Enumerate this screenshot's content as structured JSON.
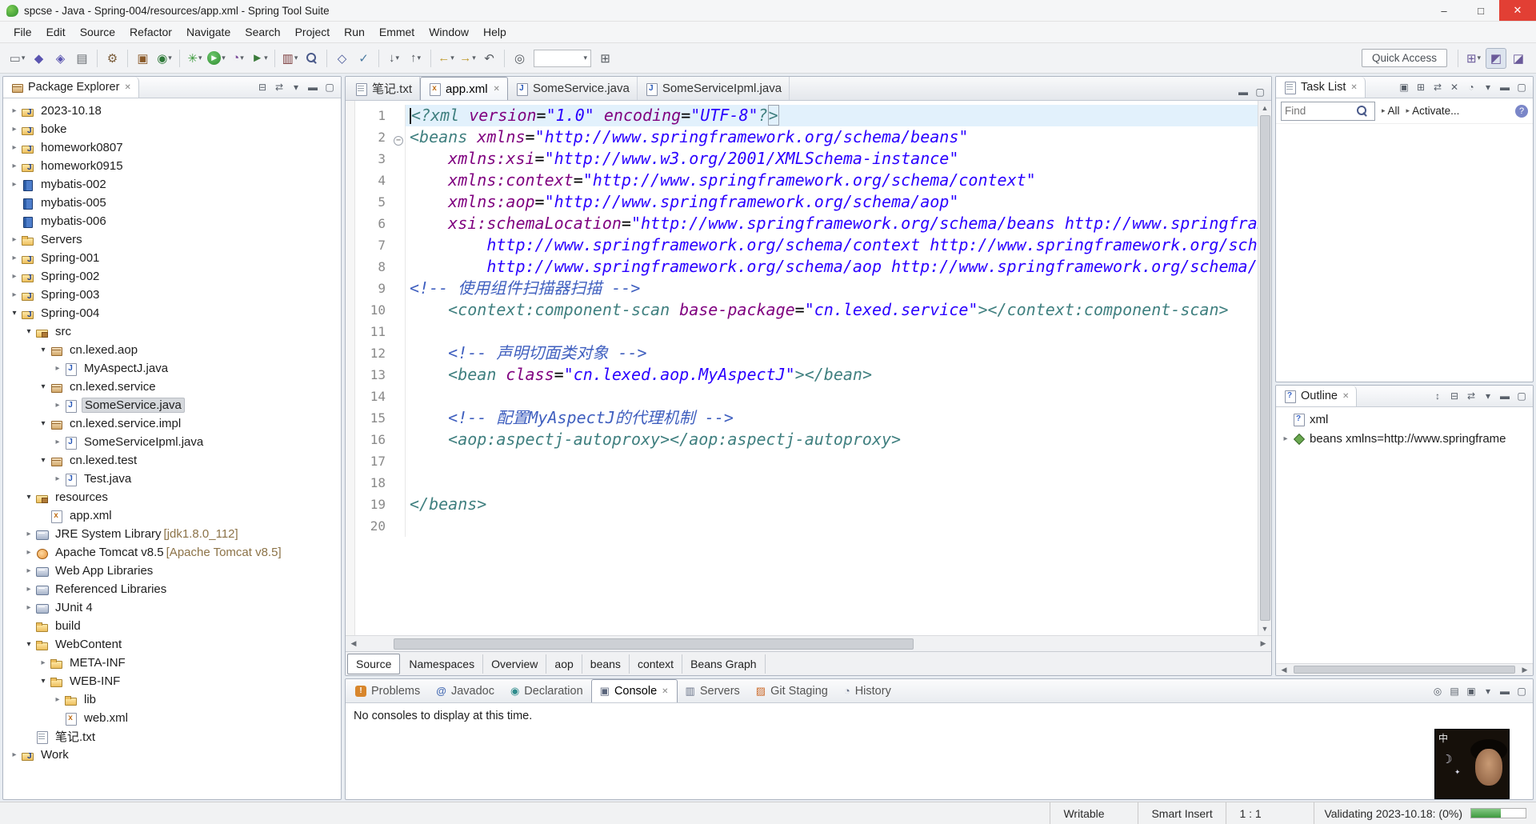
{
  "icons": {
    "window-minimize": "–",
    "window-maximize": "□",
    "window-close": "✕",
    "tab-close": "✕",
    "collapse-all": "⊟",
    "link-editor": "⇄",
    "view-menu": "▾",
    "sort": "↕",
    "minimize": "▬",
    "maximize": "▢",
    "scroll-left": "◀",
    "scroll-right": "▶",
    "scroll-up": "▲",
    "scroll-down": "▼",
    "new-task": "▣",
    "categorize": "⊞",
    "delete": "✕",
    "scheduled": "◔",
    "help": "?",
    "scope-arrow": "▸",
    "pin-console": "◎",
    "display-console": "▤",
    "open-console": "▣",
    "moon": "☽",
    "star": "✦",
    "expand-closed": "▸",
    "expand-open": "▾"
  },
  "window": {
    "title": "spcse - Java - Spring-004/resources/app.xml - Spring Tool Suite"
  },
  "menubar": [
    "File",
    "Edit",
    "Source",
    "Refactor",
    "Navigate",
    "Search",
    "Project",
    "Run",
    "Emmet",
    "Window",
    "Help"
  ],
  "toolbar": {
    "quick_access": "Quick Access",
    "buttons": [
      {
        "name": "new-file",
        "glyph": "▭",
        "color": "#6b6f76",
        "dd": true
      },
      {
        "name": "save",
        "glyph": "◆",
        "color": "#5a54b0"
      },
      {
        "name": "save-all",
        "glyph": "◈",
        "color": "#5a54b0"
      },
      {
        "name": "print",
        "glyph": "▤",
        "color": "#686c72"
      },
      {
        "sep": true
      },
      {
        "name": "build-all",
        "glyph": "⚙",
        "color": "#7a5c3a"
      },
      {
        "sep": true
      },
      {
        "name": "new-java-project",
        "glyph": "▣",
        "color": "#8a5a2a"
      },
      {
        "name": "new-java-class",
        "glyph": "◉",
        "color": "#2f7a3a",
        "dd": true
      },
      {
        "sep": true
      },
      {
        "name": "debug",
        "glyph": "✳",
        "color": "#3a9a3a",
        "dd": true
      },
      {
        "name": "run",
        "glyph": "▶",
        "cls": "run-btn",
        "dd": true
      },
      {
        "name": "profile",
        "glyph": "◔",
        "color": "#7a4a9a",
        "dd": true
      },
      {
        "name": "run-external-tools",
        "glyph": "►",
        "color": "#3a7a3a",
        "dd": true
      },
      {
        "sep": true
      },
      {
        "name": "coverage",
        "glyph": "▥",
        "color": "#7a3a3a",
        "dd": true
      },
      {
        "name": "search",
        "cssIcon": "mag"
      },
      {
        "sep": true
      },
      {
        "name": "open-type",
        "glyph": "◇",
        "color": "#4a5a9a"
      },
      {
        "name": "new-task-toolbar",
        "glyph": "✓",
        "color": "#4a7aa0"
      },
      {
        "sep": true
      },
      {
        "name": "next-annotation",
        "glyph": "↓",
        "color": "#555a60",
        "dd": true
      },
      {
        "name": "previous-annotation",
        "glyph": "↑",
        "color": "#555a60",
        "dd": true
      },
      {
        "sep": true
      },
      {
        "name": "back",
        "glyph": "←",
        "color": "#c09a2e",
        "dd": true
      },
      {
        "name": "forward",
        "glyph": "→",
        "color": "#c09a2e",
        "dd": true
      },
      {
        "name": "last-edit-location",
        "glyph": "↶",
        "color": "#555a60"
      },
      {
        "sep": true
      },
      {
        "name": "pin-editor",
        "glyph": "◎",
        "color": "#555a60"
      },
      {
        "combo": true,
        "name": "editor-presentation-combo"
      },
      {
        "name": "mark-occurrences",
        "glyph": "⊞",
        "color": "#555a60"
      }
    ],
    "perspectives": [
      {
        "name": "open-perspective",
        "glyph": "⊞",
        "dd": true
      },
      {
        "name": "perspective-jee",
        "glyph": "◩",
        "active": true
      },
      {
        "name": "perspective-java",
        "glyph": "◪"
      }
    ]
  },
  "package_explorer": {
    "title": "Package Explorer",
    "tree": [
      {
        "label": "2023-10.18",
        "level": 0,
        "icon": "project",
        "arrow": "collapsed"
      },
      {
        "label": "boke",
        "level": 0,
        "icon": "project",
        "arrow": "collapsed"
      },
      {
        "label": "homework0807",
        "level": 0,
        "icon": "project",
        "arrow": "collapsed"
      },
      {
        "label": "homework0915",
        "level": 0,
        "icon": "project",
        "arrow": "collapsed"
      },
      {
        "label": "mybatis-002",
        "level": 0,
        "icon": "book",
        "arrow": "collapsed"
      },
      {
        "label": "mybatis-005",
        "level": 0,
        "icon": "book",
        "arrow": "none"
      },
      {
        "label": "mybatis-006",
        "level": 0,
        "icon": "book",
        "arrow": "none"
      },
      {
        "label": "Servers",
        "level": 0,
        "icon": "servers",
        "arrow": "collapsed"
      },
      {
        "label": "Spring-001",
        "level": 0,
        "icon": "project",
        "arrow": "collapsed"
      },
      {
        "label": "Spring-002",
        "level": 0,
        "icon": "project",
        "arrow": "collapsed"
      },
      {
        "label": "Spring-003",
        "level": 0,
        "icon": "project",
        "arrow": "collapsed"
      },
      {
        "label": "Spring-004",
        "level": 0,
        "icon": "project",
        "arrow": "expanded"
      },
      {
        "label": "src",
        "level": 1,
        "icon": "src",
        "arrow": "expanded"
      },
      {
        "label": "cn.lexed.aop",
        "level": 2,
        "icon": "package",
        "arrow": "expanded"
      },
      {
        "label": "MyAspectJ.java",
        "level": 3,
        "icon": "java",
        "arrow": "collapsed"
      },
      {
        "label": "cn.lexed.service",
        "level": 2,
        "icon": "package",
        "arrow": "expanded"
      },
      {
        "label": "SomeService.java",
        "level": 3,
        "icon": "java",
        "arrow": "collapsed",
        "selected": true
      },
      {
        "label": "cn.lexed.service.impl",
        "level": 2,
        "icon": "package",
        "arrow": "expanded"
      },
      {
        "label": "SomeServiceIpml.java",
        "level": 3,
        "icon": "java",
        "arrow": "collapsed"
      },
      {
        "label": "cn.lexed.test",
        "level": 2,
        "icon": "package",
        "arrow": "expanded"
      },
      {
        "label": "Test.java",
        "level": 3,
        "icon": "java",
        "arrow": "collapsed"
      },
      {
        "label": "resources",
        "level": 1,
        "icon": "src",
        "arrow": "expanded"
      },
      {
        "label": "app.xml",
        "level": 2,
        "icon": "xml",
        "arrow": "none"
      },
      {
        "label": "JRE System Library [jdk1.8.0_112]",
        "level": 1,
        "icon": "library",
        "arrow": "collapsed"
      },
      {
        "label": "Apache Tomcat v8.5 [Apache Tomcat v8.5]",
        "level": 1,
        "icon": "tomcat",
        "arrow": "collapsed"
      },
      {
        "label": "Web App Libraries",
        "level": 1,
        "icon": "library",
        "arrow": "collapsed"
      },
      {
        "label": "Referenced Libraries",
        "level": 1,
        "icon": "library",
        "arrow": "collapsed"
      },
      {
        "label": "JUnit 4",
        "level": 1,
        "icon": "library",
        "arrow": "collapsed"
      },
      {
        "label": "build",
        "level": 1,
        "icon": "folder",
        "arrow": "none"
      },
      {
        "label": "WebContent",
        "level": 1,
        "icon": "folder",
        "arrow": "expanded"
      },
      {
        "label": "META-INF",
        "level": 2,
        "icon": "folder",
        "arrow": "collapsed"
      },
      {
        "label": "WEB-INF",
        "level": 2,
        "icon": "folder",
        "arrow": "expanded"
      },
      {
        "label": "lib",
        "level": 3,
        "icon": "folder",
        "arrow": "collapsed"
      },
      {
        "label": "web.xml",
        "level": 3,
        "icon": "xml",
        "arrow": "none"
      },
      {
        "label": "笔记.txt",
        "level": 1,
        "icon": "text",
        "arrow": "none"
      },
      {
        "label": "Work",
        "level": 0,
        "icon": "project",
        "arrow": "collapsed"
      }
    ]
  },
  "editor": {
    "tabs": [
      {
        "label": "笔记.txt",
        "icon": "text",
        "active": false
      },
      {
        "label": "app.xml",
        "icon": "xml",
        "active": true,
        "close": true
      },
      {
        "label": "SomeService.java",
        "icon": "java",
        "active": false
      },
      {
        "label": "SomeServiceIpml.java",
        "icon": "java",
        "active": false
      }
    ],
    "lines": [
      {
        "n": 1,
        "hl": true,
        "tokens": [
          [
            "tag",
            "<?xml "
          ],
          [
            "attr",
            "version"
          ],
          [
            "pl",
            "="
          ],
          [
            "val",
            "\"1.0\""
          ],
          [
            "pl",
            " "
          ],
          [
            "attr",
            "encoding"
          ],
          [
            "pl",
            "="
          ],
          [
            "val",
            "\"UTF-8\""
          ],
          [
            "tag",
            "?"
          ],
          [
            "box",
            ">"
          ]
        ]
      },
      {
        "n": 2,
        "fold": true,
        "tokens": [
          [
            "tag",
            "<beans "
          ],
          [
            "attr",
            "xmlns"
          ],
          [
            "pl",
            "="
          ],
          [
            "val",
            "\"http://www.springframework.org/schema/beans\""
          ]
        ]
      },
      {
        "n": 3,
        "tokens": [
          [
            "pl",
            "    "
          ],
          [
            "attr",
            "xmlns:xsi"
          ],
          [
            "pl",
            "="
          ],
          [
            "val",
            "\"http://www.w3.org/2001/XMLSchema-instance\""
          ]
        ]
      },
      {
        "n": 4,
        "tokens": [
          [
            "pl",
            "    "
          ],
          [
            "attr",
            "xmlns:context"
          ],
          [
            "pl",
            "="
          ],
          [
            "val",
            "\"http://www.springframework.org/schema/context\""
          ]
        ]
      },
      {
        "n": 5,
        "tokens": [
          [
            "pl",
            "    "
          ],
          [
            "attr",
            "xmlns:aop"
          ],
          [
            "pl",
            "="
          ],
          [
            "val",
            "\"http://www.springframework.org/schema/aop\""
          ]
        ]
      },
      {
        "n": 6,
        "tokens": [
          [
            "pl",
            "    "
          ],
          [
            "attr",
            "xsi:schemaLocation"
          ],
          [
            "pl",
            "="
          ],
          [
            "val",
            "\"http://www.springframework.org/schema/beans http://www.springframework.org/schema/beans/spring-beans.xsd"
          ]
        ]
      },
      {
        "n": 7,
        "tokens": [
          [
            "val",
            "        http://www.springframework.org/schema/context http://www.springframework.org/schema/context/spring-context.xsd"
          ]
        ]
      },
      {
        "n": 8,
        "tokens": [
          [
            "val",
            "        http://www.springframework.org/schema/aop http://www.springframework.org/schema/aop/spring-aop.xsd\""
          ],
          [
            "tag",
            ">"
          ]
        ]
      },
      {
        "n": 9,
        "tokens": [
          [
            "com",
            "<!-- 使用组件扫描器扫描 -->"
          ]
        ]
      },
      {
        "n": 10,
        "tokens": [
          [
            "pl",
            "    "
          ],
          [
            "tag",
            "<context:component-scan "
          ],
          [
            "attr",
            "base-package"
          ],
          [
            "pl",
            "="
          ],
          [
            "val",
            "\"cn.lexed.service\""
          ],
          [
            "tag",
            "></context:component-scan>"
          ]
        ]
      },
      {
        "n": 11,
        "tokens": []
      },
      {
        "n": 12,
        "tokens": [
          [
            "pl",
            "    "
          ],
          [
            "com",
            "<!-- 声明切面类对象 -->"
          ]
        ]
      },
      {
        "n": 13,
        "tokens": [
          [
            "pl",
            "    "
          ],
          [
            "tag",
            "<bean "
          ],
          [
            "attr",
            "class"
          ],
          [
            "pl",
            "="
          ],
          [
            "val",
            "\"cn.lexed.aop.MyAspectJ\""
          ],
          [
            "tag",
            "></bean>"
          ]
        ]
      },
      {
        "n": 14,
        "tokens": []
      },
      {
        "n": 15,
        "tokens": [
          [
            "pl",
            "    "
          ],
          [
            "com",
            "<!-- 配置MyAspectJ的代理机制 -->"
          ]
        ]
      },
      {
        "n": 16,
        "tokens": [
          [
            "pl",
            "    "
          ],
          [
            "tag",
            "<aop:aspectj-autoproxy></aop:aspectj-autoproxy>"
          ]
        ]
      },
      {
        "n": 17,
        "tokens": []
      },
      {
        "n": 18,
        "tokens": []
      },
      {
        "n": 19,
        "tokens": [
          [
            "tag",
            "</beans>"
          ]
        ]
      },
      {
        "n": 20,
        "tokens": []
      }
    ],
    "bottom_tabs": {
      "items": [
        "Source",
        "Namespaces",
        "Overview",
        "aop",
        "beans",
        "context",
        "Beans Graph"
      ],
      "active_index": 0
    }
  },
  "task_list": {
    "title": "Task List",
    "find_placeholder": "Find",
    "all_label": "All",
    "activate_label": "Activate..."
  },
  "outline": {
    "title": "Outline",
    "items": [
      {
        "label": "xml",
        "icon": "xmldecl",
        "arrow": "none"
      },
      {
        "label": "beans xmlns=http://www.springframe",
        "icon": "bean",
        "arrow": "collapsed"
      }
    ]
  },
  "console": {
    "tabs": [
      {
        "label": "Problems",
        "glyph": "!",
        "cls": "problems"
      },
      {
        "label": "Javadoc",
        "glyph": "@",
        "cls": "javadoc"
      },
      {
        "label": "Declaration",
        "glyph": "◉",
        "cls": "declaration"
      },
      {
        "label": "Console",
        "glyph": "▣",
        "cls": "console",
        "active": true,
        "close": true
      },
      {
        "label": "Servers",
        "glyph": "▥",
        "cls": "servers"
      },
      {
        "label": "Git Staging",
        "glyph": "▨",
        "cls": "git"
      },
      {
        "label": "History",
        "glyph": "◔",
        "cls": "history"
      }
    ],
    "message": "No consoles to display at this time."
  },
  "statusbar": {
    "writable": "Writable",
    "insert_mode": "Smart Insert",
    "caret_position": "1 : 1",
    "validating": "Validating 2023-10.18: (0%)",
    "progress_percent": 55
  },
  "webcam": {
    "text": "中"
  }
}
